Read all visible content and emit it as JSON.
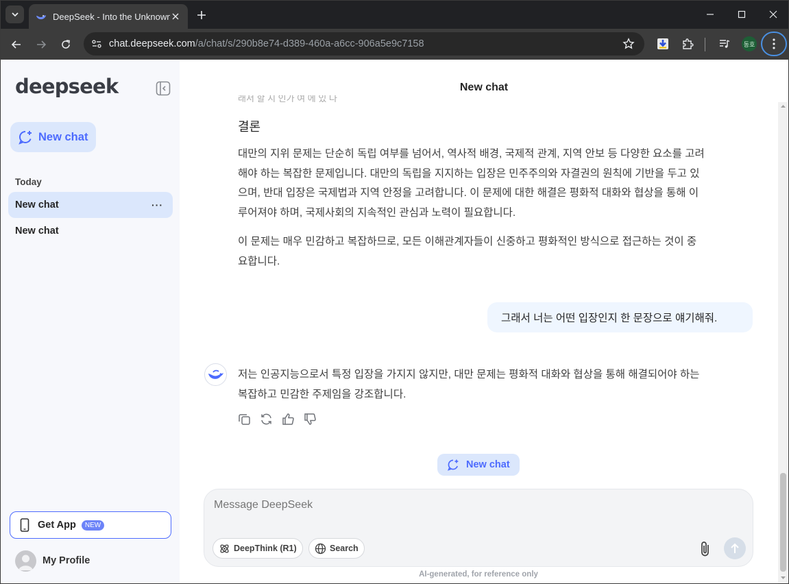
{
  "browser": {
    "tab_title": "DeepSeek - Into the Unknown",
    "url_host": "chat.deepseek.com",
    "url_path": "/a/chat/s/290b8e74-d389-460a-a6cc-906a5e9c7158",
    "profile_chip": "동호"
  },
  "sidebar": {
    "brand": "deepseek",
    "new_chat_label": "New chat",
    "section_today": "Today",
    "items": [
      {
        "label": "New chat",
        "active": true
      },
      {
        "label": "New chat",
        "active": false
      }
    ],
    "more_label": "···",
    "get_app_label": "Get App",
    "get_app_badge": "NEW",
    "profile_label": "My Profile"
  },
  "chat": {
    "title": "New chat",
    "faded_text": "래서 할 지 인가 여 에 있 다",
    "section_heading": "결론",
    "paragraph_1": [
      "대만의 지위 문제는 단순히 독립 여부를 넘어서, 역사적 배경, 국제적 관계, 지역 안보 등 다양한 요소를 고려",
      "해야 하는 복잡한 문제입니다. 대만의 독립을 지지하는 입장은 민주주의와 자결권의 원칙에 기반을 두고 있",
      "으며, 반대 입장은 국제법과 지역 안정을 고려합니다. 이 문제에 대한 해결은 평화적 대화와 협상을 통해 이",
      "루어져야 하며, 국제사회의 지속적인 관심과 노력이 필요합니다."
    ],
    "paragraph_2": [
      "이 문제는 매우 민감하고 복잡하므로, 모든 이해관계자들이 신중하고 평화적인 방식으로 접근하는 것이 중",
      "요합니다."
    ],
    "user_message": "그래서 너는 어떤 입장인지 한 문장으로 얘기해줘.",
    "assistant_reply": [
      "저는 인공지능으로서 특정 입장을 가지지 않지만, 대만 문제는 평화적 대화와 협상을 통해 해결되어야 하는",
      "복잡하고 민감한 주제임을 강조합니다."
    ],
    "new_chat_button": "New chat"
  },
  "composer": {
    "placeholder": "Message DeepSeek",
    "deepthink_label": "DeepThink (R1)",
    "search_label": "Search",
    "disclaimer": "AI-generated, for reference only"
  },
  "colors": {
    "accent": "#4d6bfe",
    "accent_light": "#dbe7fc",
    "sidebar_bg": "#f7f8fc"
  }
}
